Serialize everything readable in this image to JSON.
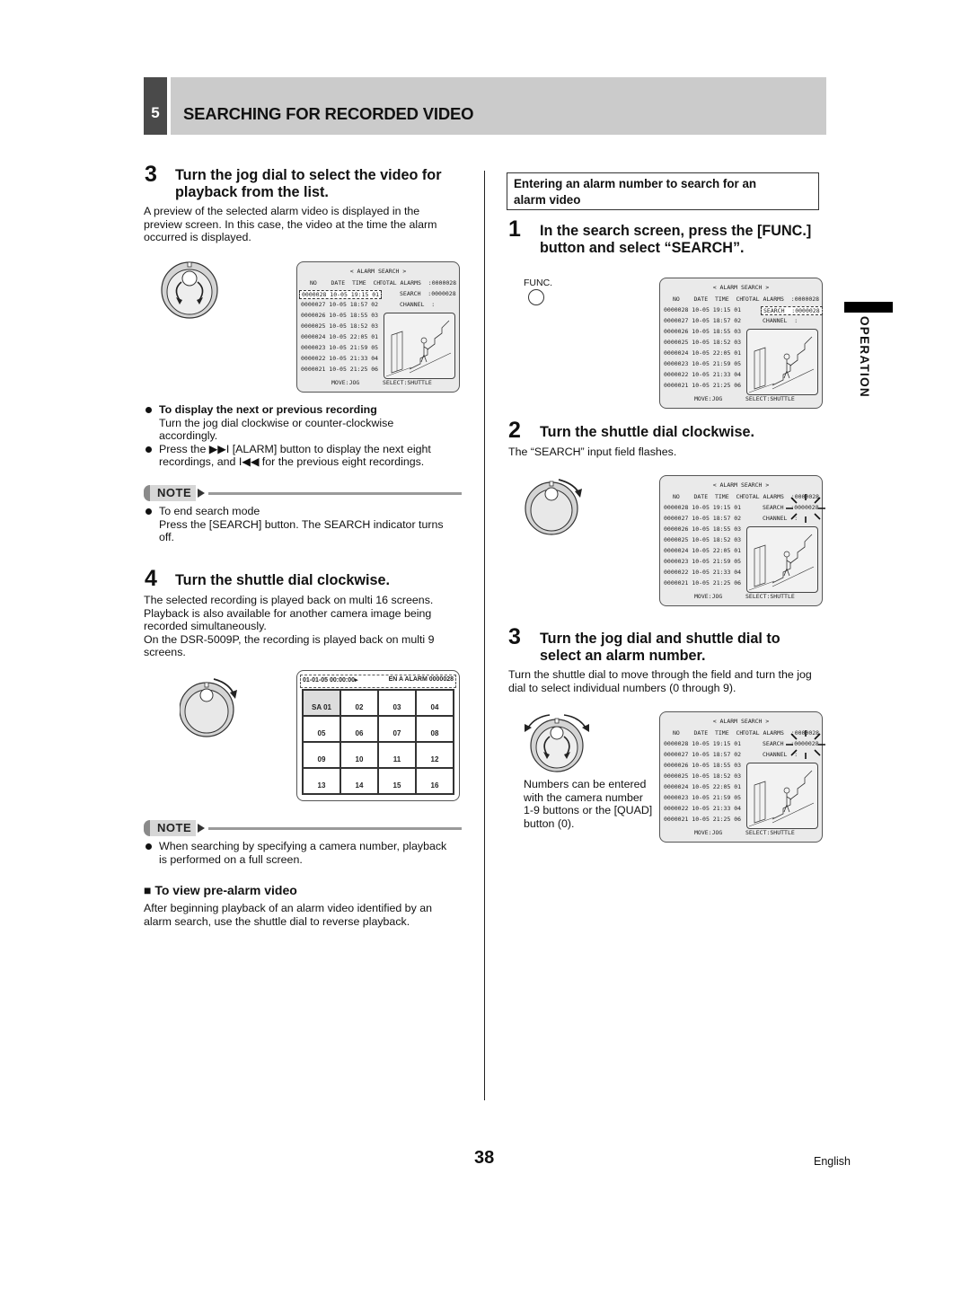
{
  "header": {
    "section_number": "5",
    "title": "SEARCHING FOR RECORDED VIDEO"
  },
  "left": {
    "step3": {
      "number": "3",
      "title_line1": "Turn the jog dial to select the video for",
      "title_line2": "playback from the list.",
      "body": [
        "A preview of the selected alarm video is displayed in the",
        "preview screen. In this case, the video at the time the alarm",
        "occurred is displayed."
      ]
    },
    "bullets": {
      "b1_title": "To display the next or previous recording",
      "b1_line1": "Turn the jog dial clockwise or counter-clockwise",
      "b1_line2": "accordingly.",
      "b2_line1": "Press the ▶▶I [ALARM] button to display the next eight",
      "b2_line2": "recordings, and I◀◀ for the previous eight recordings."
    },
    "note1": {
      "label": "NOTE",
      "line1": "To end search mode",
      "line2": "Press the [SEARCH] button. The SEARCH indicator turns",
      "line3": "off."
    },
    "step4": {
      "number": "4",
      "title": "Turn the shuttle dial clockwise.",
      "body": [
        "The selected recording is played back on multi 16 screens.",
        "Playback is also available for another camera image being",
        "recorded simultaneously.",
        "On the DSR-5009P, the recording is played back on multi 9",
        "screens."
      ]
    },
    "multiscreen": {
      "top_left": "01-01-05 00:00:00▸",
      "top_right": "EN A ALARM 0000028",
      "cells": [
        "SA   01",
        "02",
        "03",
        "04",
        "05",
        "06",
        "07",
        "08",
        "09",
        "10",
        "11",
        "12",
        "13",
        "14",
        "15",
        "16"
      ]
    },
    "note2": {
      "label": "NOTE",
      "line1": "When searching by specifying a camera number, playback",
      "line2": "is performed on a full screen."
    },
    "prealarm": {
      "heading": "■ To view pre-alarm video",
      "line1": "After beginning playback of an alarm video identified by an",
      "line2": "alarm search, use the shuttle dial to reverse playback."
    }
  },
  "alarm_screen": {
    "title": "< ALARM SEARCH >",
    "head": "NO    DATE  TIME  CH",
    "total": "TOTAL ALARMS  :0000028",
    "search": "SEARCH  :0000028",
    "channel": "CHANNEL  :",
    "rows": [
      "0000028 10-05 19:15 01",
      "0000027 10-05 18:57 02",
      "0000026 10-05 18:55 03",
      "0000025 10-05 18:52 03",
      "0000024 10-05 22:05 01",
      "0000023 10-05 21:59 05",
      "0000022 10-05 21:33 04",
      "0000021 10-05 21:25 06"
    ],
    "move": "MOVE:JOG",
    "select": "SELECT:SHUTTLE"
  },
  "right": {
    "boxed_heading_line1": "Entering an alarm number to search for an",
    "boxed_heading_line2": "alarm video",
    "step1": {
      "number": "1",
      "title_line1": "In the search screen, press the [FUNC.]",
      "title_line2": "button and select “SEARCH”.",
      "func_label": "FUNC."
    },
    "step2": {
      "number": "2",
      "title": "Turn the shuttle dial clockwise.",
      "body": "The “SEARCH” input field flashes."
    },
    "step3": {
      "number": "3",
      "title_line1": "Turn the jog dial and shuttle dial to",
      "title_line2": "select an alarm number.",
      "body_line1": "Turn the shuttle dial to move through the field and turn the jog",
      "body_line2": "dial to select individual numbers (0 through 9).",
      "caption": [
        "Numbers can be entered",
        "with the camera number",
        "1-9 buttons or the [QUAD]",
        "button (0)."
      ]
    }
  },
  "side_tab": "OPERATION",
  "footer": {
    "page_number": "38",
    "language": "English"
  }
}
